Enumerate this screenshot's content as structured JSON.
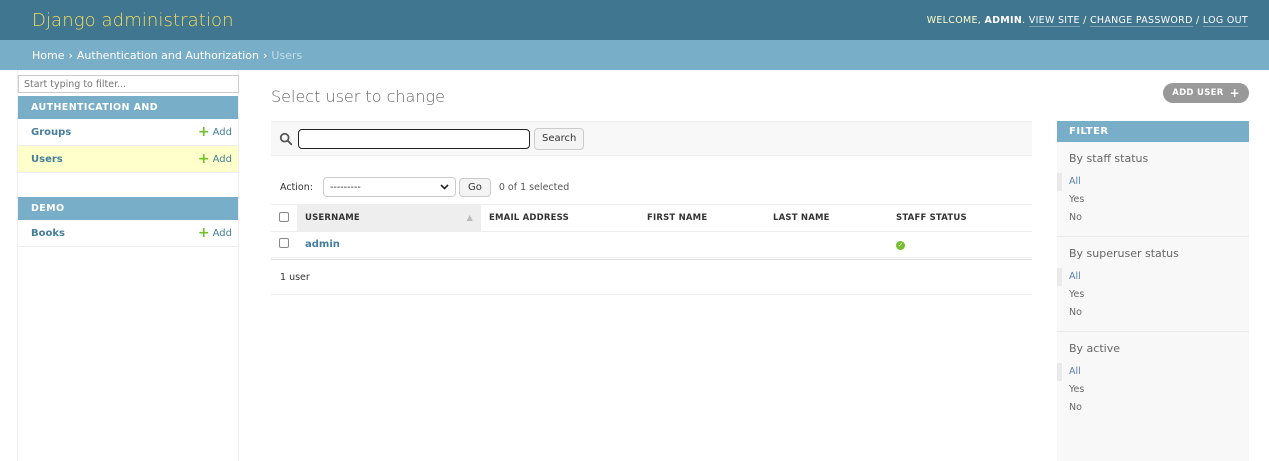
{
  "header": {
    "site_name": "Django administration",
    "welcome": "Welcome, ",
    "username": "admin",
    "view_site": "View site",
    "change_password": "Change password",
    "log_out": "Log out"
  },
  "breadcrumbs": {
    "home": "Home",
    "app": "Authentication and Authorization",
    "current": "Users"
  },
  "sidebar": {
    "filter_placeholder": "Start typing to filter...",
    "modules": [
      {
        "caption": "Authentication and Authorization",
        "models": [
          {
            "name": "Groups",
            "add": "Add",
            "current": false
          },
          {
            "name": "Users",
            "add": "Add",
            "current": true
          }
        ]
      },
      {
        "caption": "Demo",
        "models": [
          {
            "name": "Books",
            "add": "Add",
            "current": false
          }
        ]
      }
    ]
  },
  "content": {
    "title": "Select user to change",
    "add_button": "Add user",
    "search_button": "Search",
    "action_label": "Action:",
    "action_selected": "---------",
    "go_button": "Go",
    "counter": "0 of 1 selected",
    "columns": [
      "Username",
      "Email address",
      "First name",
      "Last name",
      "Staff status"
    ],
    "rows": [
      {
        "username": "admin",
        "email": "",
        "first_name": "",
        "last_name": "",
        "staff_status": true
      }
    ],
    "paginator": "1 user"
  },
  "filter": {
    "title": "Filter",
    "groups": [
      {
        "title": "By staff status",
        "options": [
          "All",
          "Yes",
          "No"
        ],
        "selected": "All"
      },
      {
        "title": "By superuser status",
        "options": [
          "All",
          "Yes",
          "No"
        ],
        "selected": "All"
      },
      {
        "title": "By active",
        "options": [
          "All",
          "Yes",
          "No"
        ],
        "selected": "All"
      }
    ]
  },
  "colors": {
    "header": "#417690",
    "breadcrumbs": "#79aec8",
    "site_name": "#f5dd5d",
    "link": "#447e9b",
    "success": "#70bf2b"
  }
}
